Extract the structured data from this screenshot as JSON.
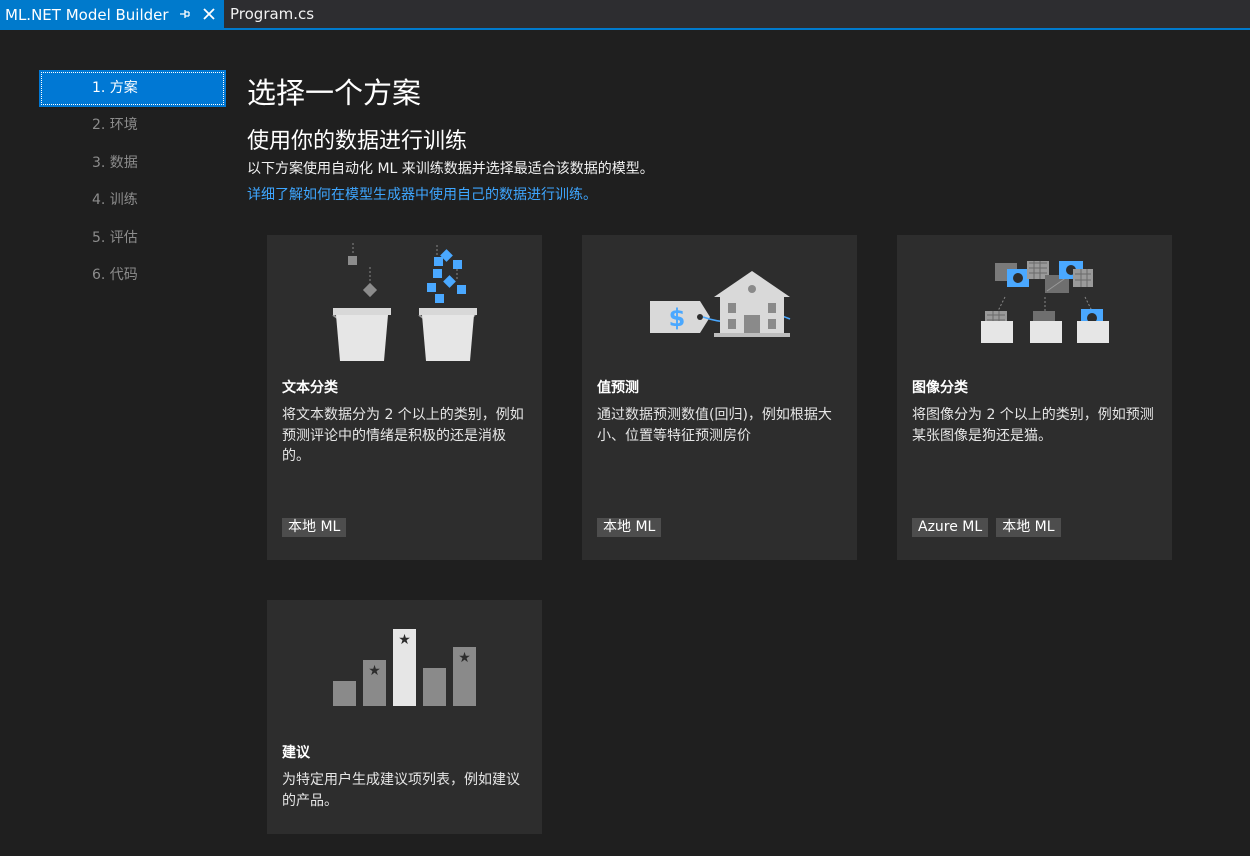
{
  "tabs": {
    "active_label": "ML.NET Model Builder",
    "inactive_label": "Program.cs"
  },
  "steps": [
    {
      "label": "1. 方案",
      "active": true
    },
    {
      "label": "2. 环境",
      "active": false
    },
    {
      "label": "3. 数据",
      "active": false
    },
    {
      "label": "4. 训练",
      "active": false
    },
    {
      "label": "5. 评估",
      "active": false
    },
    {
      "label": "6. 代码",
      "active": false
    }
  ],
  "header": {
    "title": "选择一个方案",
    "section_title": "使用你的数据进行训练",
    "description": "以下方案使用自动化 ML 来训练数据并选择最适合该数据的模型。",
    "learn_link": "详细了解如何在模型生成器中使用自己的数据进行训练。"
  },
  "cards": [
    {
      "title": "文本分类",
      "description": "将文本数据分为 2 个以上的类别，例如预测评论中的情绪是积极的还是消极的。",
      "tags": [
        "本地 ML"
      ],
      "icon": "buckets-classification-icon"
    },
    {
      "title": "值预测",
      "description": "通过数据预测数值(回归)，例如根据大小、位置等特征预测房价",
      "tags": [
        "本地 ML"
      ],
      "icon": "house-price-tag-icon"
    },
    {
      "title": "图像分类",
      "description": "将图像分为 2 个以上的类别，例如预测某张图像是狗还是猫。",
      "tags": [
        "Azure ML",
        "本地 ML"
      ],
      "icon": "image-folders-icon"
    },
    {
      "title": "建议",
      "description": "为特定用户生成建议项列表，例如建议的产品。",
      "tags": [],
      "icon": "starred-bars-icon"
    }
  ],
  "colors": {
    "accent": "#007acc",
    "selected_step": "#0078d4",
    "link": "#3ea6ff",
    "card_bg": "#2d2d2d",
    "page_bg": "#1f1f1f",
    "illustration_blue": "#4aa8ff"
  }
}
